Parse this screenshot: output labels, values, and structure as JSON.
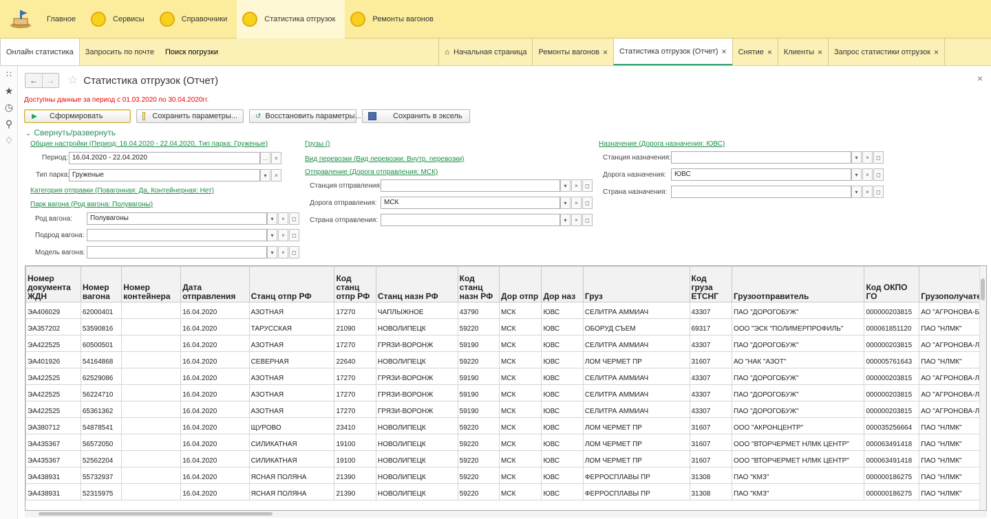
{
  "top_sections": [
    {
      "label": "Главное"
    },
    {
      "label": "Сервисы"
    },
    {
      "label": "Справочники"
    },
    {
      "label": "Статистика отгрузок"
    },
    {
      "label": "Ремонты вагонов"
    }
  ],
  "functions": [
    {
      "label": "Онлайн статистика"
    },
    {
      "label": "Запросить по почте"
    },
    {
      "label": "Поиск погрузки"
    }
  ],
  "open_tabs": [
    {
      "label": "Начальная страница"
    },
    {
      "label": "Ремонты вагонов"
    },
    {
      "label": "Статистика отгрузок (Отчет)"
    },
    {
      "label": "Снятие"
    },
    {
      "label": "Клиенты"
    },
    {
      "label": "Запрос статистики отгрузок"
    }
  ],
  "form": {
    "title": "Статистика отгрузок (Отчет)",
    "warning": "Доступны данные за период с 01.03.2020 по 30.04.2020гг.",
    "buttons": {
      "generate": "Сформировать",
      "save_params": "Сохранить параметры...",
      "restore_params": "Восстановить параметры...",
      "save_excel": "Сохранить в эксель"
    },
    "collapse": "Свернуть/развернуть"
  },
  "settings": {
    "general_link": "Общие настройки (Период: 16.04.2020 - 22.04.2020, Тип парка: Груженые)",
    "period_label": "Период:",
    "period_value": "16.04.2020 - 22.04.2020",
    "park_type_label": "Тип парка:",
    "park_type_value": "Груженые",
    "category_link": "Категория отправки (Повагонная: Да, Контейнерная: Нет)",
    "wagon_park_link": "Парк вагона (Род вагона: Полувагоны)",
    "wagon_kind_label": "Род вагона:",
    "wagon_kind_value": "Полувагоны",
    "wagon_subkind_label": "Подрод вагона:",
    "wagon_model_label": "Модель вагона:",
    "cargo_link": "Грузы ()",
    "transport_link": "Вид перевозки (Вид перевозки: Внутр. перевозки)",
    "departure_link": "Отправление (Дорога отправления: МСК)",
    "dep_station_label": "Станция отправления:",
    "dep_road_label": "Дорога отправления:",
    "dep_road_value": "МСК",
    "dep_country_label": "Страна отправления:",
    "destination_link": "Назначение (Дорога назначения: ЮВС)",
    "dst_station_label": "Станция назначения:",
    "dst_road_label": "Дорога назначения:",
    "dst_road_value": "ЮВС",
    "dst_country_label": "Страна назначения:"
  },
  "table": {
    "columns": [
      "Номер документа ЖДН",
      "Номер вагона",
      "Номер контейнера",
      "Дата отправления",
      "Станц отпр РФ",
      "Код станц отпр РФ",
      "Станц назн РФ",
      "Код станц назн РФ",
      "Дор отпр",
      "Дор наз",
      "Груз",
      "Код груза ЕТСНГ",
      "Грузоотправитель",
      "Код ОКПО ГО",
      "Грузополучател"
    ],
    "rows": [
      [
        "ЭА406029",
        "62000401",
        "",
        "16.04.2020",
        "АЗОТНАЯ",
        "17270",
        "ЧАПЛЫЖНОЕ",
        "43790",
        "МСК",
        "ЮВС",
        "СЕЛИТРА АММИАЧ",
        "43307",
        "ПАО \"ДОРОГОБУЖ\"",
        "000000203815",
        "АО \"АГРОНОВА-БЕЛГ"
      ],
      [
        "ЭА357202",
        "53590816",
        "",
        "16.04.2020",
        "ТАРУССКАЯ",
        "21090",
        "НОВОЛИПЕЦК",
        "59220",
        "МСК",
        "ЮВС",
        "ОБОРУД СЪЕМ",
        "69317",
        "ООО \"ЭСК \"ПОЛИМЕРПРОФИЛЬ\"",
        "000061851120",
        "ПАО \"НЛМК\""
      ],
      [
        "ЭА422525",
        "60500501",
        "",
        "16.04.2020",
        "АЗОТНАЯ",
        "17270",
        "ГРЯЗИ-ВОРОНЖ",
        "59190",
        "МСК",
        "ЮВС",
        "СЕЛИТРА АММИАЧ",
        "43307",
        "ПАО \"ДОРОГОБУЖ\"",
        "000000203815",
        "АО \"АГРОНОВА-ЛИПЕ"
      ],
      [
        "ЭА401926",
        "54164868",
        "",
        "16.04.2020",
        "СЕВЕРНАЯ",
        "22640",
        "НОВОЛИПЕЦК",
        "59220",
        "МСК",
        "ЮВС",
        "ЛОМ ЧЕРМЕТ ПР",
        "31607",
        "АО \"НАК \"АЗОТ\"",
        "000005761643",
        "ПАО \"НЛМК\""
      ],
      [
        "ЭА422525",
        "62529086",
        "",
        "16.04.2020",
        "АЗОТНАЯ",
        "17270",
        "ГРЯЗИ-ВОРОНЖ",
        "59190",
        "МСК",
        "ЮВС",
        "СЕЛИТРА АММИАЧ",
        "43307",
        "ПАО \"ДОРОГОБУЖ\"",
        "000000203815",
        "АО \"АГРОНОВА-ЛИПЕ"
      ],
      [
        "ЭА422525",
        "56224710",
        "",
        "16.04.2020",
        "АЗОТНАЯ",
        "17270",
        "ГРЯЗИ-ВОРОНЖ",
        "59190",
        "МСК",
        "ЮВС",
        "СЕЛИТРА АММИАЧ",
        "43307",
        "ПАО \"ДОРОГОБУЖ\"",
        "000000203815",
        "АО \"АГРОНОВА-ЛИПЕ"
      ],
      [
        "ЭА422525",
        "65361362",
        "",
        "16.04.2020",
        "АЗОТНАЯ",
        "17270",
        "ГРЯЗИ-ВОРОНЖ",
        "59190",
        "МСК",
        "ЮВС",
        "СЕЛИТРА АММИАЧ",
        "43307",
        "ПАО \"ДОРОГОБУЖ\"",
        "000000203815",
        "АО \"АГРОНОВА-ЛИПЕ"
      ],
      [
        "ЭА380712",
        "54878541",
        "",
        "16.04.2020",
        "ЩУРОВО",
        "23410",
        "НОВОЛИПЕЦК",
        "59220",
        "МСК",
        "ЮВС",
        "ЛОМ ЧЕРМЕТ ПР",
        "31607",
        "ООО \"АКРОНЦЕНТР\"",
        "000035256664",
        "ПАО \"НЛМК\""
      ],
      [
        "ЭА435367",
        "56572050",
        "",
        "16.04.2020",
        "СИЛИКАТНАЯ",
        "19100",
        "НОВОЛИПЕЦК",
        "59220",
        "МСК",
        "ЮВС",
        "ЛОМ ЧЕРМЕТ ПР",
        "31607",
        "ООО \"ВТОРЧЕРМЕТ НЛМК ЦЕНТР\"",
        "000063491418",
        "ПАО \"НЛМК\""
      ],
      [
        "ЭА435367",
        "52562204",
        "",
        "16.04.2020",
        "СИЛИКАТНАЯ",
        "19100",
        "НОВОЛИПЕЦК",
        "59220",
        "МСК",
        "ЮВС",
        "ЛОМ ЧЕРМЕТ ПР",
        "31607",
        "ООО \"ВТОРЧЕРМЕТ НЛМК ЦЕНТР\"",
        "000063491418",
        "ПАО \"НЛМК\""
      ],
      [
        "ЭА438931",
        "55732937",
        "",
        "16.04.2020",
        "ЯСНАЯ ПОЛЯНА",
        "21390",
        "НОВОЛИПЕЦК",
        "59220",
        "МСК",
        "ЮВС",
        "ФЕРРОСПЛАВЫ ПР",
        "31308",
        "ПАО \"КМЗ\"",
        "000000186275",
        "ПАО \"НЛМК\""
      ],
      [
        "ЭА438931",
        "52315975",
        "",
        "16.04.2020",
        "ЯСНАЯ ПОЛЯНА",
        "21390",
        "НОВОЛИПЕЦК",
        "59220",
        "МСК",
        "ЮВС",
        "ФЕРРОСПЛАВЫ ПР",
        "31308",
        "ПАО \"КМЗ\"",
        "000000186275",
        "ПАО \"НЛМК\""
      ]
    ]
  },
  "colors": {
    "top_panel": "#fbec9e",
    "section_circle": "#f7d21c",
    "link_green": "#1a8d44",
    "warning_red": "#e00000",
    "active_tab_underline": "#29a06b"
  }
}
